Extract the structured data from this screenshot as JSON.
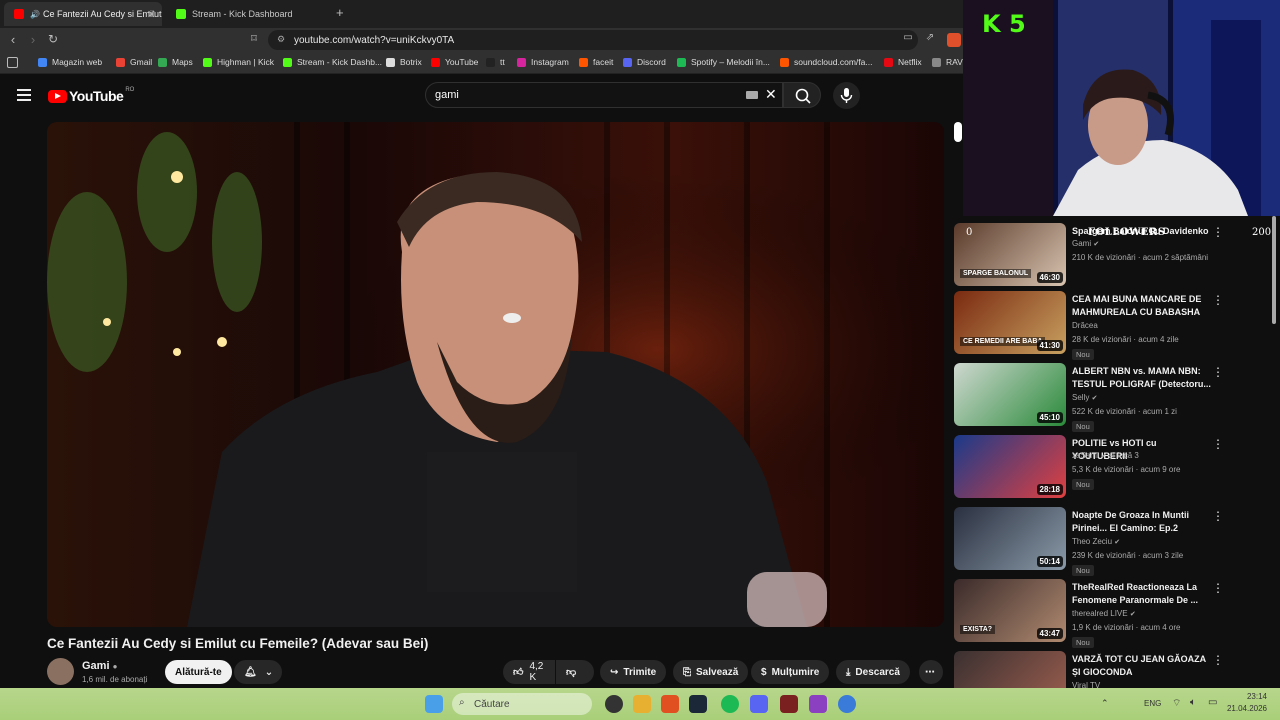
{
  "browser": {
    "tabs": [
      {
        "label": "Ce Fantezii Au Cedy si Emilut",
        "active": true
      },
      {
        "label": "Stream - Kick Dashboard",
        "active": false
      }
    ],
    "new_tab": "+",
    "url": "youtube.com/watch?v=uniKckvy0TA",
    "bookmarks": [
      {
        "label": "Magazin web",
        "color": "#4285f4"
      },
      {
        "label": "Gmail",
        "color": "#ea4335"
      },
      {
        "label": "Maps",
        "color": "#34a853"
      },
      {
        "label": "Highman | Kick",
        "color": "#53fc18"
      },
      {
        "label": "Stream - Kick Dashb...",
        "color": "#53fc18"
      },
      {
        "label": "Botrix",
        "color": "#dddddd"
      },
      {
        "label": "YouTube",
        "color": "#ff0000"
      },
      {
        "label": "tt",
        "color": "#222222"
      },
      {
        "label": "Instagram",
        "color": "#d6249f"
      },
      {
        "label": "faceit",
        "color": "#ff5500"
      },
      {
        "label": "Discord",
        "color": "#5865f2"
      },
      {
        "label": "Spotify – Melodii în...",
        "color": "#1db954"
      },
      {
        "label": "soundcloud.com/fa...",
        "color": "#ff5500"
      },
      {
        "label": "Netflix",
        "color": "#e50914"
      },
      {
        "label": "RAV",
        "color": "#888888"
      }
    ]
  },
  "youtube": {
    "logo_text": "YouTube",
    "country": "RO",
    "search_value": "gami"
  },
  "video": {
    "title": "Ce Fantezii Au Cedy si Emilut cu Femeile? (Adevar sau Bei)",
    "channel": "Gami",
    "subscribers": "1,6 mil. de abonați",
    "join_label": "Alătură-te",
    "likes": "4,2 K",
    "share_label": "Trimite",
    "save_label": "Salvează",
    "thanks_label": "Mulțumire",
    "download_label": "Descarcă"
  },
  "recommendations": [
    {
      "title": "Spargem Balonul Cu Davidenko",
      "channel": "Gami",
      "verified": true,
      "meta": "210 K de vizionări · acum 2 săptămâni",
      "new": "",
      "duration": "46:30",
      "thumb_text": "SPARGE BALONUL",
      "c1": "#5a3a2a",
      "c2": "#d8c4b0"
    },
    {
      "title": "CEA MAI BUNA MANCARE DE MAHMUREALA CU BABASHA",
      "channel": "Drăcea",
      "verified": false,
      "meta": "28 K de vizionări · acum 4 zile",
      "new": "Nou",
      "duration": "41:30",
      "thumb_text": "CE REMEDII ARE BABA",
      "c1": "#7a2a10",
      "c2": "#c8a060"
    },
    {
      "title": "ALBERT NBN vs. MAMA NBN: TESTUL POLIGRAF (Detectoru...",
      "channel": "Selly",
      "verified": true,
      "meta": "522 K de vizionări · acum 1 zi",
      "new": "Nou",
      "duration": "45:10",
      "thumb_text": "",
      "c1": "#cfd8d0",
      "c2": "#2a8a3a"
    },
    {
      "title": "POLITIE vs HOTI cu YOUTUBERII",
      "channel": "zaSami",
      "verified": true,
      "channel_extra": "și încă 3",
      "meta": "5,3 K de vizionări · acum 9 ore",
      "new": "Nou",
      "duration": "28:18",
      "thumb_text": "",
      "c1": "#1a3a8a",
      "c2": "#e04040"
    },
    {
      "title": "Noapte De Groaza In Muntii Pirinei... El Camino: Ep.2",
      "channel": "Theo Zeciu",
      "verified": true,
      "meta": "239 K de vizionări · acum 3 zile",
      "new": "Nou",
      "duration": "50:14",
      "thumb_text": "",
      "c1": "#2a3040",
      "c2": "#8a9aa8"
    },
    {
      "title": "TheRealRed Reactioneaza La Fenomene Paranormale De ...",
      "channel": "therealred LIVE",
      "verified": true,
      "meta": "1,9 K de vizionări · acum 4 ore",
      "new": "Nou",
      "duration": "43:47",
      "thumb_text": "EXISTA?",
      "c1": "#3a2a2a",
      "c2": "#b08a70"
    },
    {
      "title": "VARZĂ TOT CU JEAN GĂOAZA ȘI GIOCONDA",
      "channel": "Viral TV",
      "verified": false,
      "meta": "",
      "new": "",
      "duration": "",
      "thumb_text": "",
      "c1": "#3a3030",
      "c2": "#a06050"
    }
  ],
  "overlay": {
    "kick_logo": "K 5",
    "followers_label": "FOLLOWERS",
    "followers_current": "0",
    "followers_goal": "200"
  },
  "taskbar": {
    "search_placeholder": "Căutare",
    "language": "ENG",
    "time": "23:14",
    "date": "21.04.2026"
  }
}
